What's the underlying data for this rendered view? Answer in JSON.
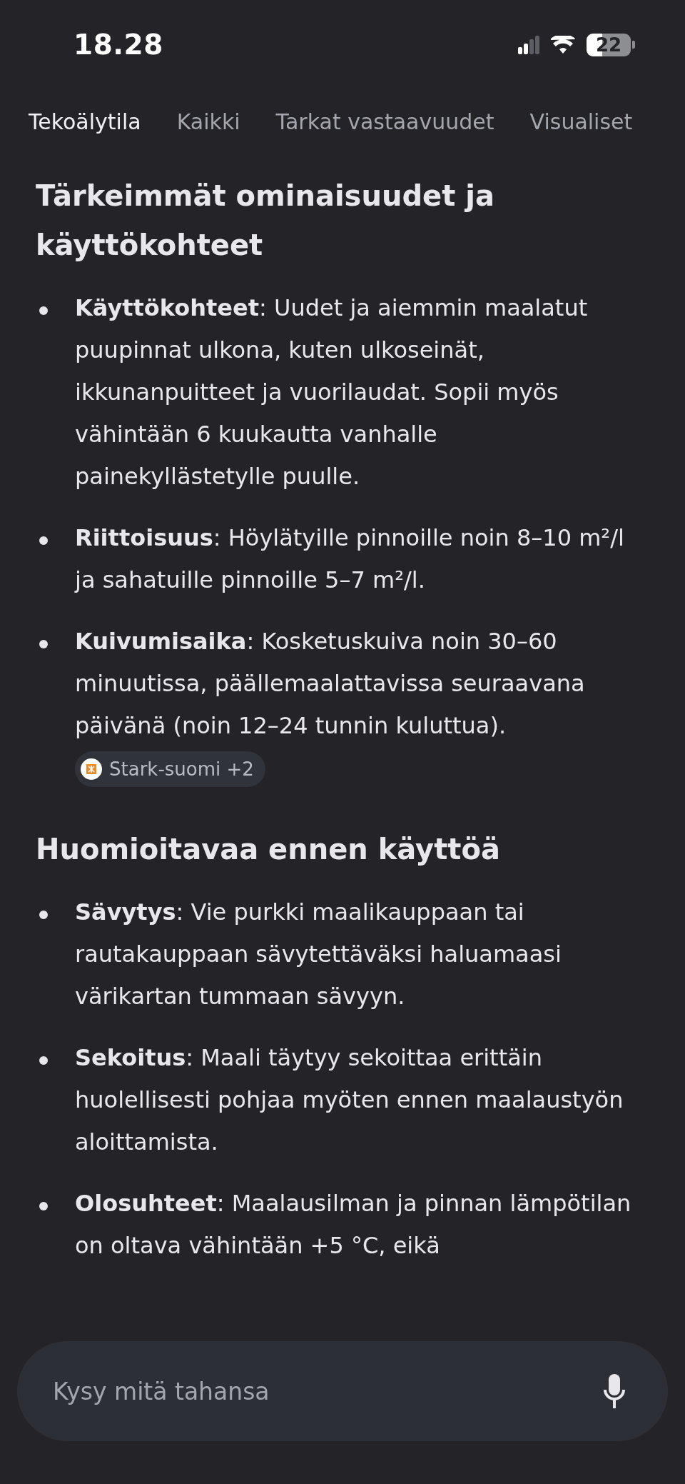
{
  "status_bar": {
    "time": "18.28",
    "battery": "22"
  },
  "tabs": [
    {
      "label": "Tekoälytila",
      "selected": true
    },
    {
      "label": "Kaikki",
      "selected": false
    },
    {
      "label": "Tarkat vastaavuudet",
      "selected": false
    },
    {
      "label": "Visualiset",
      "selected": false
    }
  ],
  "sections": [
    {
      "heading": "Tärkeimmät ominaisuudet ja käyttökohteet",
      "items": [
        {
          "text": "**Käyttökohteet**: Uudet ja aiemmin maalatut puupinnat ulkona, kuten ulkoseinät, ikkunanpuitteet ja vuorilaudat. Sopii myös vähintään 6 kuukautta vanhalle painekyllästetylle puulle."
        },
        {
          "text": "**Riittoisuus**: Höylätyille pinnoille noin 8–10 m²/l ja sahatuille pinnoille 5–7 m²/l."
        },
        {
          "text": "**Kuivumisaika**: Kosketuskuiva noin 30–60 minuutissa, päällemaalattavissa seuraavana päivänä (noin 12–24 tunnin kuluttua).",
          "source": "Stark-suomi +2"
        }
      ]
    },
    {
      "heading": "Huomioitavaa ennen käyttöä",
      "items": [
        {
          "text": "**Sävytys**: Vie purkki maalikauppaan tai rautakauppaan sävytettäväksi haluamaasi värikartan tummaan sävyyn."
        },
        {
          "text": "**Sekoitus**: Maali täytyy sekoittaa erittäin huolellisesti pohjaa myöten ennen maalaustyön aloittamista."
        },
        {
          "text": "**Olosuhteet**: Maalausilman ja pinnan lämpötilan on oltava vähintään +5 °C, eikä"
        }
      ]
    }
  ],
  "search": {
    "placeholder": "Kysy mitä tahansa"
  }
}
